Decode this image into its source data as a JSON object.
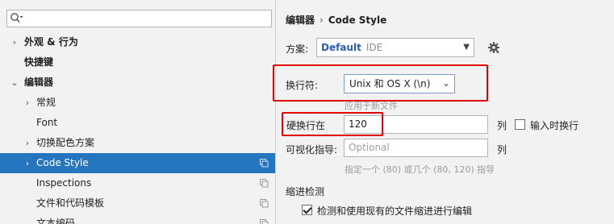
{
  "search": {
    "placeholder": ""
  },
  "tree": [
    {
      "label": "外观 & 行为",
      "arrow": "›",
      "bold": true
    },
    {
      "label": "快捷键",
      "arrow": "",
      "bold": true
    },
    {
      "label": "编辑器",
      "arrow": "⌄",
      "bold": true
    },
    {
      "label": "常规",
      "arrow": "›",
      "bold": false
    },
    {
      "label": "Font",
      "arrow": "",
      "bold": false
    },
    {
      "label": "切换配色方案",
      "arrow": "›",
      "bold": false
    },
    {
      "label": "Code Style",
      "arrow": "›",
      "bold": false
    },
    {
      "label": "Inspections",
      "arrow": "",
      "bold": false
    },
    {
      "label": "文件和代码模板",
      "arrow": "",
      "bold": false
    },
    {
      "label": "文本编码",
      "arrow": "",
      "bold": false
    }
  ],
  "breadcrumb": {
    "parent": "编辑器",
    "separator": "›",
    "current": "Code Style"
  },
  "scheme": {
    "label": "方案:",
    "name": "Default",
    "tag": "IDE"
  },
  "line_separator": {
    "label": "换行符:",
    "value": "Unix 和 OS X (\\n)",
    "hint": "应用于新文件"
  },
  "hard_wrap": {
    "label": "硬换行在",
    "value": "120",
    "unit": "列",
    "checkbox_label": "输入时换行"
  },
  "visual_guides": {
    "label": "可视化指导:",
    "placeholder": "Optional",
    "unit": "列",
    "hint": "指定一个 (80) 或几个 (80, 120) 指导"
  },
  "indent_detection": {
    "title": "缩进检测",
    "checkbox_label": "检测和使用现有的文件缩进进行编辑"
  },
  "colors": {
    "selection": "#2675bf",
    "highlight": "#e00000",
    "link": "#2a5db0"
  }
}
